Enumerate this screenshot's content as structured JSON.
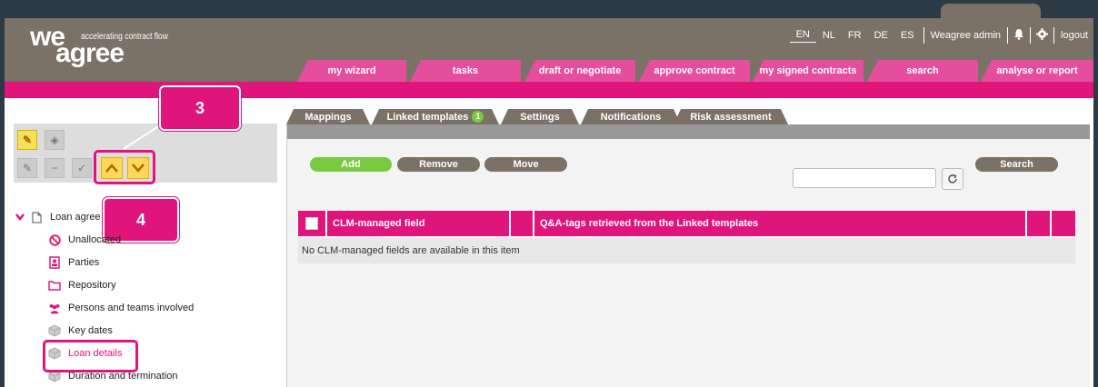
{
  "brand": {
    "logo_we": "we",
    "logo_agree": "agree",
    "tagline": "accelerating contract flow"
  },
  "header": {
    "languages": [
      "EN",
      "NL",
      "FR",
      "DE",
      "ES"
    ],
    "active_language": "EN",
    "user": "Weagree admin",
    "logout": "logout",
    "icons": [
      "bell-icon",
      "gear-icon"
    ]
  },
  "nav": {
    "tabs": [
      "my wizard",
      "tasks",
      "draft or negotiate",
      "approve contract",
      "my signed contracts",
      "search",
      "analyse or report"
    ]
  },
  "callouts": {
    "three": "3",
    "four": "4"
  },
  "tree": {
    "root_label": "Loan agree",
    "items": [
      {
        "label": "Unallocated",
        "icon": "no-entry-icon"
      },
      {
        "label": "Parties",
        "icon": "contact-card-icon"
      },
      {
        "label": "Repository",
        "icon": "folder-icon"
      },
      {
        "label": "Persons and teams involved",
        "icon": "people-icon"
      },
      {
        "label": "Key dates",
        "icon": "cube-icon"
      },
      {
        "label": "Loan details",
        "icon": "cube-icon"
      },
      {
        "label": "Duration and termination",
        "icon": "cube-icon"
      }
    ]
  },
  "main": {
    "tabs": [
      {
        "label": "Mappings"
      },
      {
        "label": "Linked templates",
        "badge": "1"
      },
      {
        "label": "Settings"
      },
      {
        "label": "Notifications"
      },
      {
        "label": "Risk assessment"
      }
    ],
    "buttons": {
      "add": "Add",
      "remove": "Remove",
      "move": "Move",
      "search": "Search"
    },
    "search_value": "",
    "table": {
      "col1": "CLM-managed field",
      "col2": "Q&A-tags retrieved from the Linked templates",
      "empty": "No CLM-managed fields are available in this item"
    }
  },
  "colors": {
    "brand_pink": "#e0157b",
    "nav_pink": "#e44e9c",
    "header_brown": "#7b7167",
    "green": "#7ac943"
  }
}
